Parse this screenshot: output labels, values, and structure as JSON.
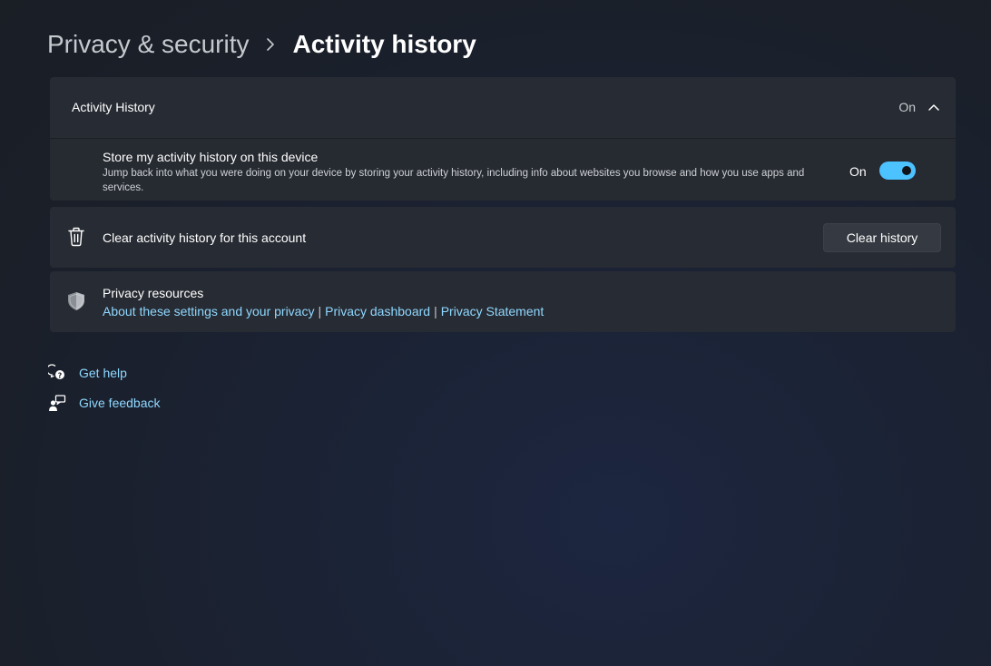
{
  "breadcrumb": {
    "parent": "Privacy & security",
    "current": "Activity history"
  },
  "activity_card": {
    "title": "Activity History",
    "state": "On",
    "expanded": true,
    "store_setting": {
      "title": "Store my activity history on this device",
      "description": "Jump back into what you were doing on your device by storing your activity history, including info about websites you browse and how you use apps and services.",
      "toggle_label": "On",
      "toggle_on": true
    }
  },
  "clear_card": {
    "label": "Clear activity history for this account",
    "button_label": "Clear history",
    "icon": "trash-icon"
  },
  "privacy_resources": {
    "title": "Privacy resources",
    "icon": "shield-icon",
    "links": [
      "About these settings and your privacy",
      "Privacy dashboard",
      "Privacy Statement"
    ],
    "separator": "|"
  },
  "help": {
    "get_help": "Get help",
    "give_feedback": "Give feedback"
  },
  "colors": {
    "accent": "#4cc2ff",
    "link": "#8fd8ff",
    "card_bg": "#272b33"
  }
}
